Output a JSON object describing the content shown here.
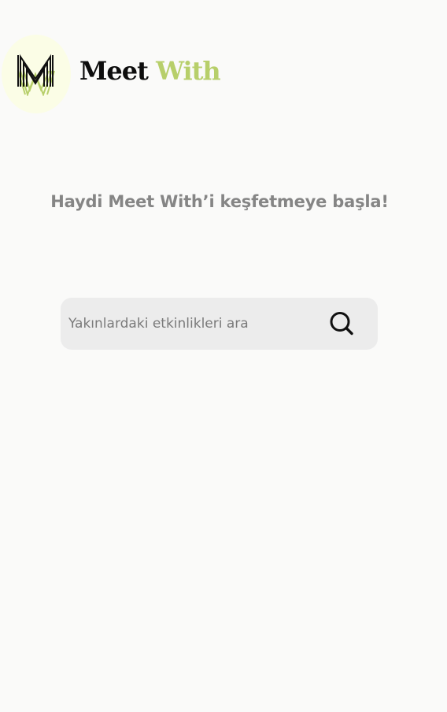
{
  "header": {
    "brand_first": "Meet",
    "brand_second": "With",
    "logo_icon": "meet-with-logo-icon"
  },
  "main": {
    "tagline": "Haydi Meet With’i keşfetmeye başla!"
  },
  "search": {
    "placeholder": "Yakınlardaki etkinlikleri ara",
    "value": "",
    "icon": "search-icon"
  },
  "colors": {
    "background": "#fafaf9",
    "accent_green": "#b7cf6a",
    "logo_circle": "#fbfde6",
    "tagline": "#858585",
    "search_bg": "#ececec"
  }
}
